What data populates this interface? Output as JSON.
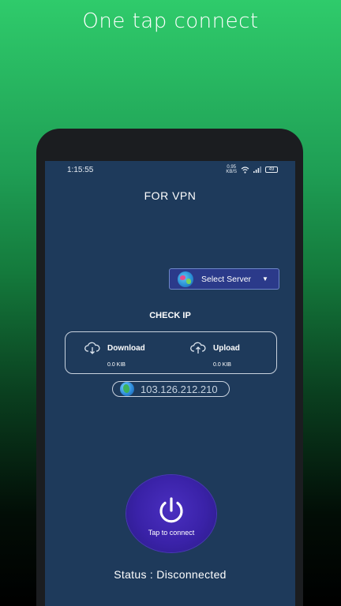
{
  "promo": {
    "title": "One tap connect"
  },
  "status_bar": {
    "time": "1:15:55",
    "net_speed_value": "0.95",
    "net_speed_unit": "KB/S",
    "battery": "49"
  },
  "app": {
    "title": "FOR VPN"
  },
  "server_select": {
    "label": "Select Server"
  },
  "check_ip": {
    "label": "CHECK IP"
  },
  "traffic": {
    "download": {
      "label": "Download",
      "value": "0.0 KIB"
    },
    "upload": {
      "label": "Upload",
      "value": "0.0 KIB"
    }
  },
  "ip": {
    "address": "103.126.212.210"
  },
  "connect": {
    "label": "Tap to connect"
  },
  "status": {
    "text": "Status : Disconnected"
  },
  "colors": {
    "background_top": "#2fcb6b",
    "screen_bg": "#1e3a5b",
    "server_button": "#2b3a8a",
    "connect_button": "#3a22a8"
  }
}
